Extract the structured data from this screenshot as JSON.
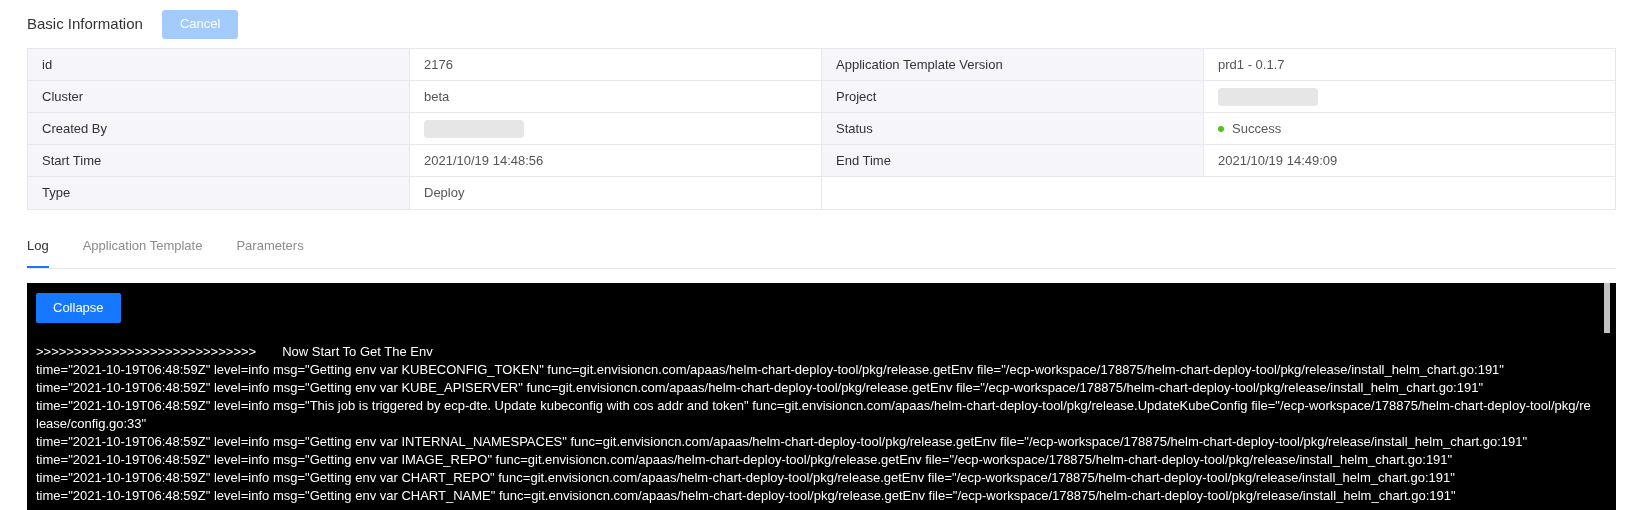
{
  "header": {
    "title": "Basic Information",
    "cancel_button": {
      "label": "Cancel",
      "disabled": true
    }
  },
  "info_table": [
    [
      {
        "label": "id",
        "value": "2176"
      },
      {
        "label": "Application Template Version",
        "value": "prd1 - 0.1.7"
      }
    ],
    [
      {
        "label": "Cluster",
        "value": "beta"
      },
      {
        "label": "Project",
        "kind": "blurred"
      }
    ],
    [
      {
        "label": "Created By",
        "kind": "blurred"
      },
      {
        "label": "Status",
        "value": "Success",
        "kind": "status",
        "color": "#52c41a"
      }
    ],
    [
      {
        "label": "Start Time",
        "value": "2021/10/19 14:48:56"
      },
      {
        "label": "End Time",
        "value": "2021/10/19 14:49:09"
      }
    ],
    [
      {
        "label": "Type",
        "value": "Deploy"
      }
    ]
  ],
  "tabs": [
    {
      "label": "Log",
      "selected": true
    },
    {
      "label": "Application Template",
      "selected": false
    },
    {
      "label": "Parameters",
      "selected": false
    }
  ],
  "log": {
    "collapse_button": "Collapse",
    "banner": {
      "arrows": ">>>>>>>>>>>>>>>>>>>>>>>>>>>>>",
      "text": "Now Start To Get The Env"
    },
    "lines": [
      "time=\"2021-10-19T06:48:59Z\" level=info msg=\"Getting env var KUBECONFIG_TOKEN\" func=git.envisioncn.com/apaas/helm-chart-deploy-tool/pkg/release.getEnv file=\"/ecp-workspace/178875/helm-chart-deploy-tool/pkg/release/install_helm_chart.go:191\"",
      "time=\"2021-10-19T06:48:59Z\" level=info msg=\"Getting env var KUBE_APISERVER\" func=git.envisioncn.com/apaas/helm-chart-deploy-tool/pkg/release.getEnv file=\"/ecp-workspace/178875/helm-chart-deploy-tool/pkg/release/install_helm_chart.go:191\"",
      "time=\"2021-10-19T06:48:59Z\" level=info msg=\"This job is triggered by ecp-dte. Update kubeconfig with cos addr and token\" func=git.envisioncn.com/apaas/helm-chart-deploy-tool/pkg/release.UpdateKubeConfig file=\"/ecp-workspace/178875/helm-chart-deploy-tool/pkg/release/config.go:33\"",
      "time=\"2021-10-19T06:48:59Z\" level=info msg=\"Getting env var INTERNAL_NAMESPACES\" func=git.envisioncn.com/apaas/helm-chart-deploy-tool/pkg/release.getEnv file=\"/ecp-workspace/178875/helm-chart-deploy-tool/pkg/release/install_helm_chart.go:191\"",
      "time=\"2021-10-19T06:48:59Z\" level=info msg=\"Getting env var IMAGE_REPO\" func=git.envisioncn.com/apaas/helm-chart-deploy-tool/pkg/release.getEnv file=\"/ecp-workspace/178875/helm-chart-deploy-tool/pkg/release/install_helm_chart.go:191\"",
      "time=\"2021-10-19T06:48:59Z\" level=info msg=\"Getting env var CHART_REPO\" func=git.envisioncn.com/apaas/helm-chart-deploy-tool/pkg/release.getEnv file=\"/ecp-workspace/178875/helm-chart-deploy-tool/pkg/release/install_helm_chart.go:191\"",
      "time=\"2021-10-19T06:48:59Z\" level=info msg=\"Getting env var CHART_NAME\" func=git.envisioncn.com/apaas/helm-chart-deploy-tool/pkg/release.getEnv file=\"/ecp-workspace/178875/helm-chart-deploy-tool/pkg/release/install_helm_chart.go:191\""
    ]
  }
}
